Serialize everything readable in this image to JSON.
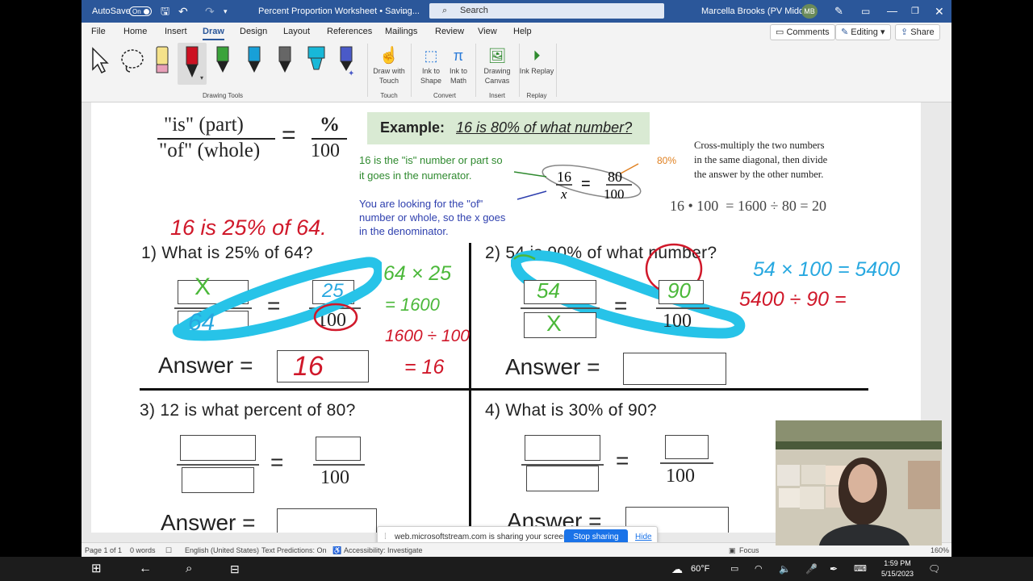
{
  "titlebar": {
    "autosave_label": "AutoSave",
    "autosave_state": "On",
    "doc_title": "Percent Proportion Worksheet • Saving...",
    "search_placeholder": "Search",
    "user_name": "Marcella Brooks (PV Middle)",
    "user_initials": "MB"
  },
  "menu": {
    "items": [
      "File",
      "Home",
      "Insert",
      "Draw",
      "Design",
      "Layout",
      "References",
      "Mailings",
      "Review",
      "View",
      "Help"
    ],
    "active": "Draw",
    "comments_label": "Comments",
    "editing_label": "Editing",
    "share_label": "Share"
  },
  "ribbon": {
    "drawing_tools_label": "Drawing Tools",
    "draw_with_touch": "Draw with Touch",
    "ink_to_shape": "Ink to Shape",
    "ink_to_math": "Ink to Math",
    "drawing_canvas": "Drawing Canvas",
    "ink_replay": "Ink Replay",
    "group_touch": "Touch",
    "group_convert": "Convert",
    "group_insert": "Insert",
    "group_replay": "Replay",
    "pen_colors": [
      "#e8a0b8",
      "#cc1122",
      "#3aa33a",
      "#18a0d8",
      "#666666",
      "#18b8d8",
      "#4a5ac8"
    ]
  },
  "doc": {
    "is_part": "\"is\" (part)",
    "of_whole": "\"of\" (whole)",
    "percent_symbol": "%",
    "hundred": "100",
    "example_label": "Example:",
    "example_text": "16 is 80% of what number?",
    "note1_a": "16 is the \"is\" number or part so",
    "note1_b": "it goes in the numerator.",
    "note2_a": "You are looking for the \"of\"",
    "note2_b": "number or whole, so the x goes",
    "note2_c": "in the denominator.",
    "ex_num": "16",
    "ex_den": "x",
    "ex_num2": "80",
    "ex_den2": "100",
    "ex_pct": "80%",
    "cross_a": "Cross-multiply the two numbers",
    "cross_b": "in the same diagonal, then divide",
    "cross_c": "the answer by the other number.",
    "cross_eq": "16 • 100  = 1600 ÷ 80 = 20",
    "q1": "1)  What is 25% of 64?",
    "q2": "2)  54 is 90% of what number?",
    "q3": "3)  12 is what percent of 80?",
    "q4": "4)  What is 30% of 90?",
    "answer_label": "Answer =",
    "eq_sign": "="
  },
  "ink": {
    "q_top": "16 is 25% of 64.",
    "q1_num": "X",
    "q1_den": "64",
    "q1_pct": "25",
    "q1_ans": "16",
    "q1_work1": "64 × 25",
    "q1_work2": "= 1600",
    "q1_work3": "1600 ÷ 100",
    "q1_work4": "= 16",
    "q2_num": "54",
    "q2_den": "X",
    "q2_pct": "90",
    "q2_work1": "54 × 100 = 5400",
    "q2_work2": "5400 ÷ 90 ="
  },
  "statusbar": {
    "page": "Page 1 of 1",
    "words": "0 words",
    "language": "English (United States)",
    "predictions": "Text Predictions: On",
    "accessibility": "Accessibility: Investigate",
    "focus": "Focus",
    "zoom": "160%"
  },
  "sharebar": {
    "message": "web.microsoftstream.com is sharing your screen.",
    "stop_label": "Stop sharing",
    "hide_label": "Hide"
  },
  "taskbar": {
    "weather": "60°F",
    "time": "1:59 PM",
    "date": "5/15/2023"
  }
}
